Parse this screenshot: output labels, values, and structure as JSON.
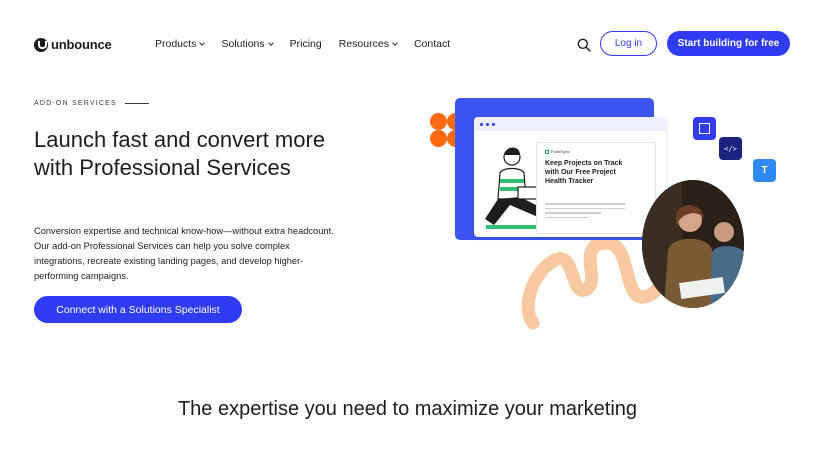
{
  "nav": {
    "logo": "unbounce",
    "menu": [
      {
        "label": "Products",
        "dropdown": true
      },
      {
        "label": "Solutions",
        "dropdown": true
      },
      {
        "label": "Pricing",
        "dropdown": false
      },
      {
        "label": "Resources",
        "dropdown": true
      },
      {
        "label": "Contact",
        "dropdown": false
      }
    ],
    "search_icon": "search-icon",
    "login_label": "Log in",
    "cta_label": "Start building for free"
  },
  "hero": {
    "eyebrow": "ADD-ON SERVICES",
    "headline": "Launch fast and convert more with Professional Services",
    "description": "Conversion expertise and technical know-how—without extra headcount. Our add-on Professional Services can help you solve complex integrations, recreate existing landing pages, and develop higher-performing campaigns.",
    "cta_label": "Connect with a Solutions Specialist"
  },
  "illustration": {
    "doc_brand": "PulseSync",
    "doc_title": "Keep Projects on Track with Our Free Project Health Tracker",
    "code_tile": "</>",
    "type_tile": "T"
  },
  "section": {
    "heading": "The expertise you need to maximize your marketing"
  },
  "colors": {
    "accent": "#2f3cf4",
    "orange": "#ff6a13",
    "peach": "#f8c9a0"
  }
}
